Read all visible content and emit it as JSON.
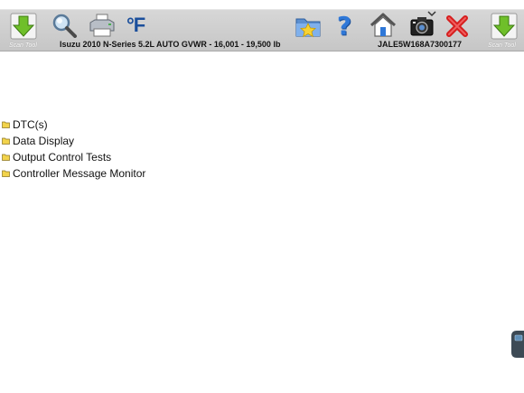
{
  "toolbar": {
    "left_scan_label": "Scan Tool",
    "right_scan_label": "Scan Tool",
    "icons": {
      "scan_tool_left": "down-arrow-icon",
      "search": "magnifier-icon",
      "print": "printer-icon",
      "units": "fahrenheit-icon",
      "favorites": "folder-star-icon",
      "help": "question-mark-icon",
      "home": "home-icon",
      "screenshot": "camera-icon",
      "close": "close-x-icon",
      "scan_tool_right": "down-arrow-icon"
    },
    "units_label": "°F",
    "help_glyph": "?"
  },
  "vehicle": {
    "description": "Isuzu  2010  N-Series  5.2L  AUTO GVWR - 16,001 - 19,500 lb",
    "vin": "JALE5W168A7300177"
  },
  "menu": {
    "items": [
      {
        "label": "DTC(s)"
      },
      {
        "label": "Data Display"
      },
      {
        "label": "Output Control Tests"
      },
      {
        "label": "Controller Message Monitor"
      }
    ]
  },
  "colors": {
    "toolbar_bg": "#cccccc",
    "arrow_green": "#6fbf2a",
    "help_blue": "#2f78d8",
    "close_red": "#d61e1e",
    "folder_yellow": "#f2d34b"
  }
}
